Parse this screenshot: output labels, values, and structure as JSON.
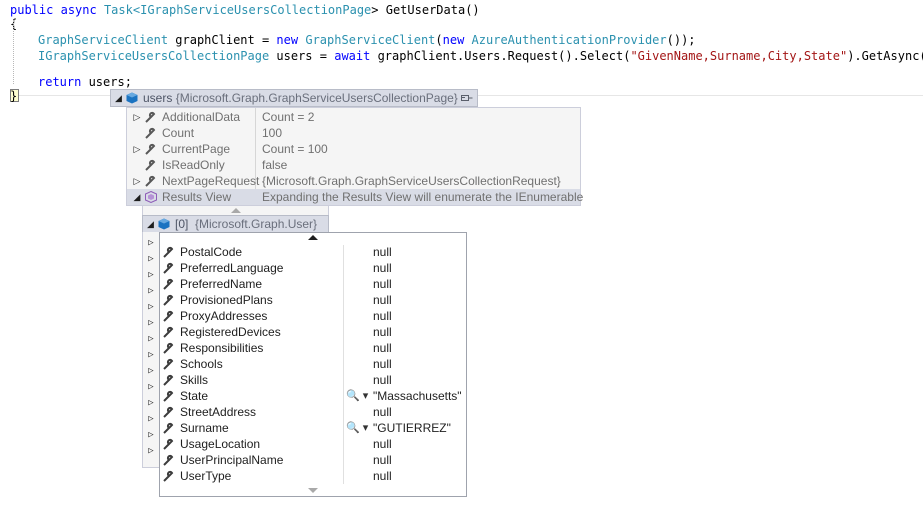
{
  "code": {
    "l1": {
      "kw1": "public",
      "kw2": "async",
      "ty1": "Task",
      "p1": "<",
      "ty2": "IGraphServiceUsersCollectionPage",
      "p2": "> GetUserData()"
    },
    "l2": "{",
    "l3": {
      "ty1": "GraphServiceClient",
      "p1": " graphClient = ",
      "kw1": "new",
      "sp": " ",
      "ty2": "GraphServiceClient",
      "p2": "(",
      "kw2": "new",
      "sp2": " ",
      "ty3": "AzureAuthenticationProvider",
      "p3": "());"
    },
    "l4": {
      "ty1": "IGraphServiceUsersCollectionPage",
      "p1": " users = ",
      "kw1": "await",
      "p2": " graphClient.Users.Request().Select(",
      "st1": "\"GivenName,Surname,City,State\"",
      "p3": ").GetAsync();"
    },
    "l5": {
      "kw1": "return",
      "p1": " users;"
    },
    "l6": "}"
  },
  "tip_header": {
    "name": "users",
    "type": "{Microsoft.Graph.GraphServiceUsersCollectionPage}"
  },
  "tip_rows": [
    {
      "name": "AdditionalData",
      "value": "Count = 2",
      "expandable": "▷"
    },
    {
      "name": "Count",
      "value": "100",
      "expandable": ""
    },
    {
      "name": "CurrentPage",
      "value": "Count = 100",
      "expandable": "▷"
    },
    {
      "name": "IsReadOnly",
      "value": "false",
      "expandable": ""
    },
    {
      "name": "NextPageRequest",
      "value": "{Microsoft.Graph.GraphServiceUsersCollectionRequest}",
      "expandable": "▷"
    },
    {
      "name": "Results View",
      "value": "Expanding the Results View will enumerate the IEnumerable",
      "expandable": "◢"
    }
  ],
  "user_header": {
    "index": "[0]",
    "type": "{Microsoft.Graph.User}"
  },
  "user_rows": [
    {
      "name": "PostalCode",
      "value": "null",
      "search": ""
    },
    {
      "name": "PreferredLanguage",
      "value": "null",
      "search": ""
    },
    {
      "name": "PreferredName",
      "value": "null",
      "search": ""
    },
    {
      "name": "ProvisionedPlans",
      "value": "null",
      "search": ""
    },
    {
      "name": "ProxyAddresses",
      "value": "null",
      "search": ""
    },
    {
      "name": "RegisteredDevices",
      "value": "null",
      "search": ""
    },
    {
      "name": "Responsibilities",
      "value": "null",
      "search": ""
    },
    {
      "name": "Schools",
      "value": "null",
      "search": ""
    },
    {
      "name": "Skills",
      "value": "null",
      "search": ""
    },
    {
      "name": "State",
      "value": "\"Massachusetts\"",
      "search": "🔍 ▾"
    },
    {
      "name": "StreetAddress",
      "value": "null",
      "search": ""
    },
    {
      "name": "Surname",
      "value": "\"GUTIERREZ\"",
      "search": "🔍 ▾"
    },
    {
      "name": "UsageLocation",
      "value": "null",
      "search": ""
    },
    {
      "name": "UserPrincipalName",
      "value": "null",
      "search": ""
    },
    {
      "name": "UserType",
      "value": "null",
      "search": ""
    }
  ],
  "colors": {
    "keyword": "#0000ff",
    "type": "#2b91af",
    "string": "#a31515",
    "header_bg": "#d9dce6"
  }
}
